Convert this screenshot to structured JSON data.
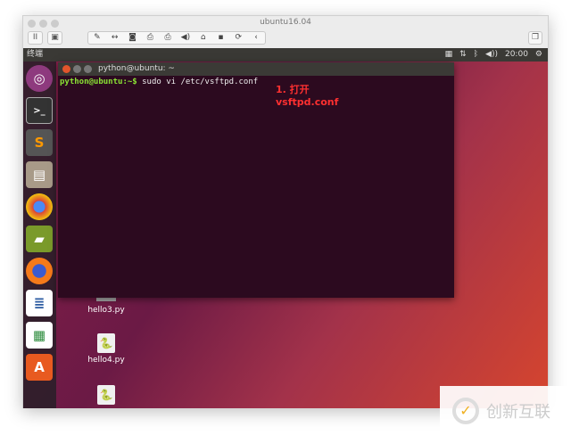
{
  "window": {
    "title": "ubuntu16.04"
  },
  "toolbar": {
    "icons": [
      "wrench-icon",
      "arrows-icon",
      "disk-icon",
      "printer-icon",
      "printer2-icon",
      "speaker-icon",
      "usb-icon",
      "floppy-icon",
      "refresh-icon",
      "chevron-left-icon"
    ]
  },
  "topbar": {
    "app_name": "终端",
    "time": "20:00"
  },
  "launcher": {
    "items": [
      "ubuntu-dash",
      "terminal",
      "sublime-text",
      "files",
      "chrome",
      "books",
      "firefox",
      "writer",
      "calc",
      "software-center"
    ]
  },
  "terminal": {
    "title": "python@ubuntu: ~",
    "prompt": "python@ubuntu:~$",
    "command": " sudo vi /etc/vsftpd.conf"
  },
  "annotation": {
    "line1": "1. 打开",
    "line2": "vsftpd.conf"
  },
  "desktop": {
    "files": [
      "hello3.py",
      "hello4.py"
    ]
  },
  "watermark": {
    "text": "创新互联"
  }
}
